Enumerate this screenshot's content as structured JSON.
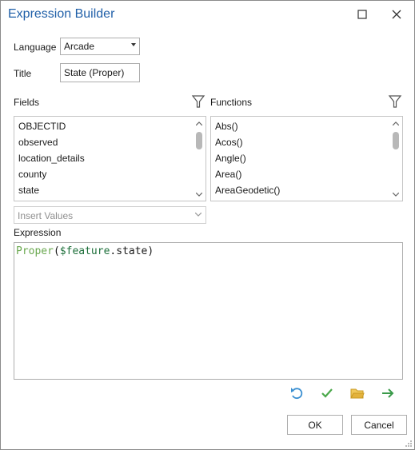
{
  "window": {
    "title": "Expression Builder"
  },
  "form": {
    "language_label": "Language",
    "language_value": "Arcade",
    "title_label": "Title",
    "title_value": "State (Proper)"
  },
  "fields": {
    "label": "Fields",
    "items": [
      "OBJECTID",
      "observed",
      "location_details",
      "county",
      "state"
    ]
  },
  "functions": {
    "label": "Functions",
    "items": [
      "Abs()",
      "Acos()",
      "Angle()",
      "Area()",
      "AreaGeodetic()"
    ]
  },
  "insert_values": {
    "placeholder": "Insert Values"
  },
  "expression": {
    "label": "Expression",
    "tokens": {
      "fn": "Proper",
      "open": "(",
      "var": "$feature",
      "dot": ".state",
      "close": ")"
    }
  },
  "buttons": {
    "ok": "OK",
    "cancel": "Cancel"
  },
  "toolbar_icons": [
    "undo-icon",
    "verify-check-icon",
    "open-folder-icon",
    "run-arrow-icon"
  ],
  "colors": {
    "title": "#1f5fa8",
    "function_token": "#6aa84f",
    "variable_token": "#1d6f3a",
    "undo": "#3a8fd1",
    "check": "#4aa84a",
    "folder": "#e3b23c",
    "arrow": "#3a9a4a"
  }
}
